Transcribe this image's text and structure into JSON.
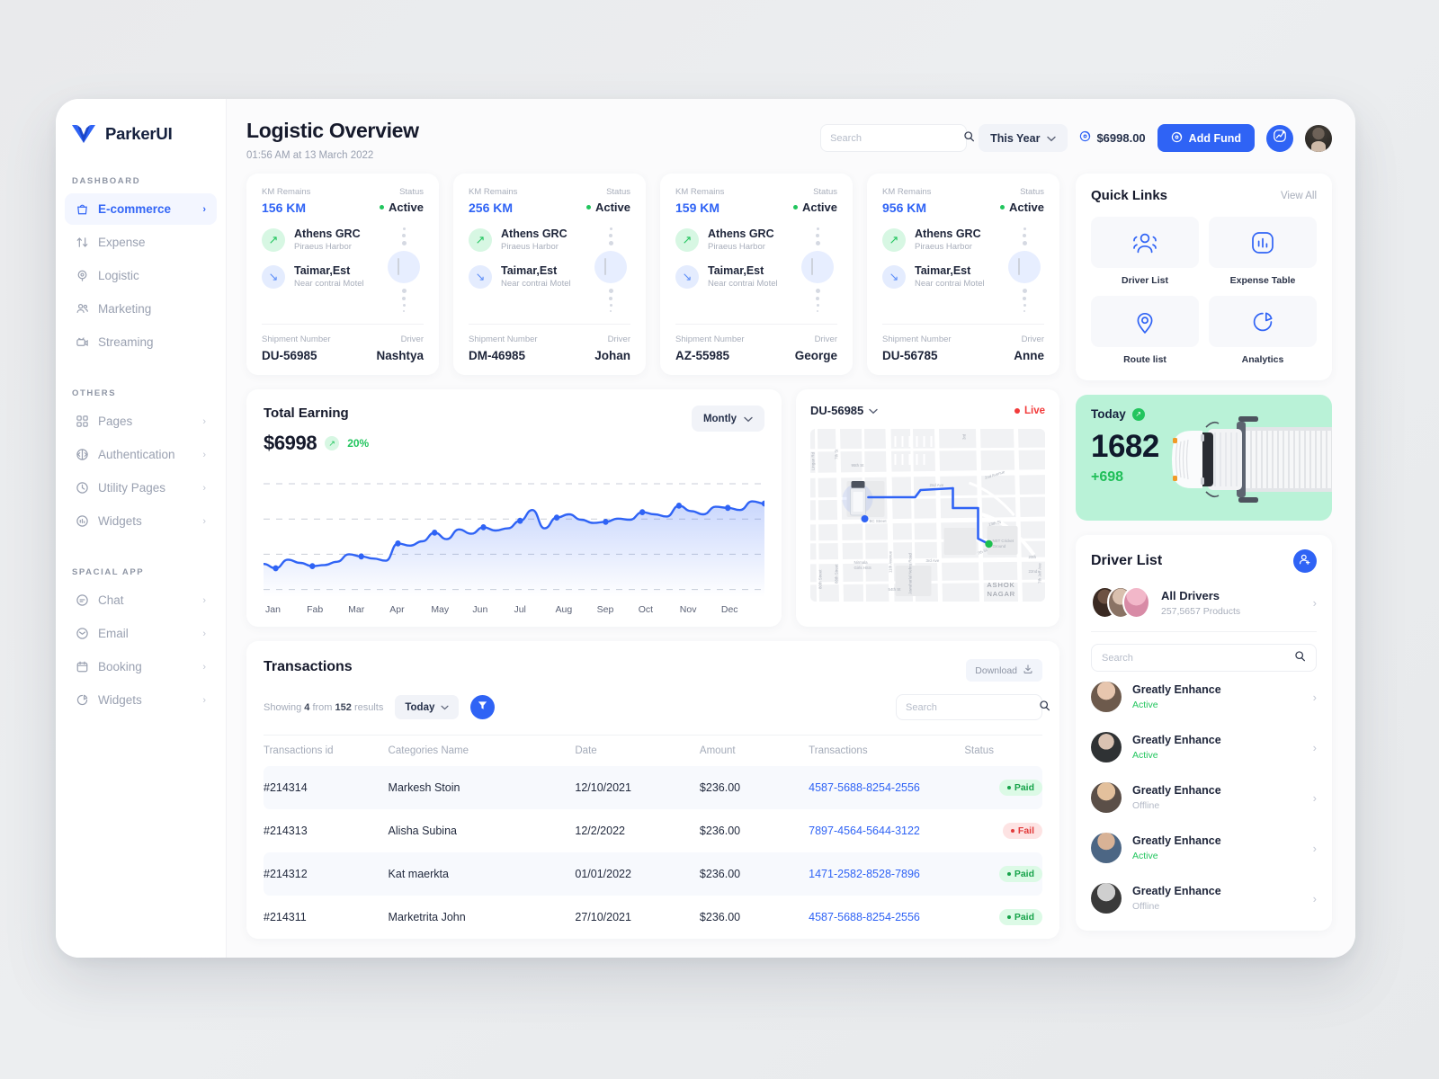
{
  "brand": {
    "name": "ParkerUI"
  },
  "sidebar": {
    "sections": [
      {
        "label": "DASHBOARD",
        "items": [
          {
            "label": "E-commerce",
            "icon": "bag-icon",
            "active": true,
            "chevron": "›"
          },
          {
            "label": "Expense",
            "icon": "transfer-icon",
            "active": false,
            "chevron": ""
          },
          {
            "label": "Logistic",
            "icon": "pin-icon",
            "active": false,
            "chevron": ""
          },
          {
            "label": "Marketing",
            "icon": "users-icon",
            "active": false,
            "chevron": ""
          },
          {
            "label": "Streaming",
            "icon": "stream-icon",
            "active": false,
            "chevron": ""
          }
        ]
      },
      {
        "label": "OTHERS",
        "items": [
          {
            "label": "Pages",
            "icon": "grid-icon",
            "active": false,
            "chevron": "›"
          },
          {
            "label": "Authentication",
            "icon": "auth-icon",
            "active": false,
            "chevron": "›"
          },
          {
            "label": "Utility Pages",
            "icon": "clock-icon",
            "active": false,
            "chevron": "›"
          },
          {
            "label": "Widgets",
            "icon": "chart-icon",
            "active": false,
            "chevron": "›"
          }
        ]
      },
      {
        "label": "SPACIAL APP",
        "items": [
          {
            "label": "Chat",
            "icon": "chat-icon",
            "active": false,
            "chevron": "›"
          },
          {
            "label": "Email",
            "icon": "mail-icon",
            "active": false,
            "chevron": "›"
          },
          {
            "label": "Booking",
            "icon": "calendar-icon",
            "active": false,
            "chevron": "›"
          },
          {
            "label": "Widgets",
            "icon": "pie-icon",
            "active": false,
            "chevron": "›"
          }
        ]
      }
    ]
  },
  "header": {
    "title": "Logistic Overview",
    "subtitle": "01:56 AM at 13 March 2022",
    "search_placeholder": "Search",
    "search_value": "",
    "period_label": "This Year",
    "balance": "$6998.00",
    "add_fund_label": "Add Fund"
  },
  "shipments": [
    {
      "km_label": "KM Remains",
      "km": "156 KM",
      "status_label": "Status",
      "status": "Active",
      "origin": "Athens GRC",
      "origin_sub": "Piraeus Harbor",
      "dest": "Taimar,Est",
      "dest_sub": "Near contrai Motel",
      "shipment_label": "Shipment Number",
      "shipment": "DU-56985",
      "driver_label": "Driver",
      "driver": "Nashtya"
    },
    {
      "km_label": "KM Remains",
      "km": "256 KM",
      "status_label": "Status",
      "status": "Active",
      "origin": "Athens GRC",
      "origin_sub": "Piraeus Harbor",
      "dest": "Taimar,Est",
      "dest_sub": "Near contrai Motel",
      "shipment_label": "Shipment Number",
      "shipment": "DM-46985",
      "driver_label": "Driver",
      "driver": "Johan"
    },
    {
      "km_label": "KM Remains",
      "km": "159 KM",
      "status_label": "Status",
      "status": "Active",
      "origin": "Athens GRC",
      "origin_sub": "Piraeus Harbor",
      "dest": "Taimar,Est",
      "dest_sub": "Near contrai Motel",
      "shipment_label": "Shipment Number",
      "shipment": "AZ-55985",
      "driver_label": "Driver",
      "driver": "George"
    },
    {
      "km_label": "KM Remains",
      "km": "956 KM",
      "status_label": "Status",
      "status": "Active",
      "origin": "Athens GRC",
      "origin_sub": "Piraeus Harbor",
      "dest": "Taimar,Est",
      "dest_sub": "Near contrai Motel",
      "shipment_label": "Shipment Number",
      "shipment": "DU-56785",
      "driver_label": "Driver",
      "driver": "Anne"
    }
  ],
  "earning": {
    "title": "Total Earning",
    "amount": "$6998",
    "change": "20%",
    "period_label": "Montly"
  },
  "chart_data": {
    "type": "area",
    "title": "Total Earning",
    "xlabel": "",
    "ylabel": "",
    "grid": true,
    "legend": null,
    "accent": "#2f63f5",
    "categories": [
      "Jan",
      "Fab",
      "Mar",
      "Apr",
      "May",
      "Jun",
      "Jul",
      "Aug",
      "Sep",
      "Oct",
      "Nov",
      "Dec"
    ],
    "tick_labels": [
      "Jan",
      "Fab",
      "Mar",
      "Apr",
      "May",
      "Jun",
      "Jul",
      "Aug",
      "Sep",
      "Oct",
      "Nov",
      "Dec"
    ],
    "ylim": [
      0,
      100
    ],
    "marker_values": [
      28,
      26,
      31,
      43,
      52,
      56,
      55,
      64,
      73,
      63,
      70,
      75,
      80
    ],
    "values": [
      24,
      20,
      28,
      25,
      22,
      23,
      26,
      33,
      31,
      29,
      27,
      43,
      41,
      45,
      53,
      47,
      56,
      52,
      58,
      55,
      57,
      64,
      74,
      57,
      67,
      70,
      65,
      62,
      63,
      66,
      65,
      72,
      70,
      68,
      78,
      73,
      70,
      77,
      76,
      74,
      82,
      80
    ]
  },
  "map": {
    "shipment_id": "DU-56985",
    "live_label": "Live",
    "labels": [
      "Lingan Rd",
      "7th St",
      "95th St",
      "Nirmala Girls HSS",
      "60th St",
      "80th Street",
      "11th Avenue",
      "Jawaharlal Nehru Road",
      "54th St",
      "80 Street",
      "BC Street",
      "2nd Ave",
      "3rd Ave",
      "2nd Avenue",
      "13th St",
      "7th St",
      "NST Cricket Ground",
      "20th",
      "22nd",
      "7th Jeff Ave",
      "ASHOK NAGAR"
    ]
  },
  "quick_links": {
    "title": "Quick Links",
    "view_all": "View All",
    "items": [
      {
        "label": "Driver List",
        "icon": "users-group-icon"
      },
      {
        "label": "Expense Table",
        "icon": "bar-chart-icon"
      },
      {
        "label": "Route list",
        "icon": "location-pin-icon"
      },
      {
        "label": "Analytics",
        "icon": "pie-chart-icon"
      }
    ]
  },
  "today": {
    "label": "Today",
    "value": "1682",
    "delta": "+698"
  },
  "driver_list": {
    "title": "Driver List",
    "all_drivers_name": "All Drivers",
    "all_drivers_sub": "257,5657 Products",
    "search_placeholder": "Search",
    "search_value": "",
    "drivers": [
      {
        "name": "Greatly Enhance",
        "status": "Active"
      },
      {
        "name": "Greatly Enhance",
        "status": "Active"
      },
      {
        "name": "Greatly Enhance",
        "status": "Offline"
      },
      {
        "name": "Greatly Enhance",
        "status": "Active"
      },
      {
        "name": "Greatly Enhance",
        "status": "Offline"
      }
    ]
  },
  "transactions": {
    "title": "Transactions",
    "download_label": "Download",
    "showing_prefix": "Showing",
    "showing_count": "4",
    "showing_mid": "from",
    "showing_total": "152",
    "showing_suffix": "results",
    "period_label": "Today",
    "search_placeholder": "Search",
    "search_value": "",
    "columns": [
      "Transactions id",
      "Categories Name",
      "Date",
      "Amount",
      "Transactions",
      "Status"
    ],
    "rows": [
      {
        "id": "#214314",
        "category": "Markesh Stoin",
        "date": "12/10/2021",
        "amount": "$236.00",
        "txn": "4587-5688-8254-2556",
        "status": "Paid"
      },
      {
        "id": "#214313",
        "category": "Alisha Subina",
        "date": "12/2/2022",
        "amount": "$236.00",
        "txn": "7897-4564-5644-3122",
        "status": "Fail"
      },
      {
        "id": "#214312",
        "category": "Kat maerkta",
        "date": "01/01/2022",
        "amount": "$236.00",
        "txn": "1471-2582-8528-7896",
        "status": "Paid"
      },
      {
        "id": "#214311",
        "category": "Marketrita John",
        "date": "27/10/2021",
        "amount": "$236.00",
        "txn": "4587-5688-8254-2556",
        "status": "Paid"
      }
    ]
  },
  "colors": {
    "accent": "#2f63f5",
    "success": "#22c55e",
    "danger": "#f23b3b",
    "today_bg": "#b9f2d7"
  }
}
